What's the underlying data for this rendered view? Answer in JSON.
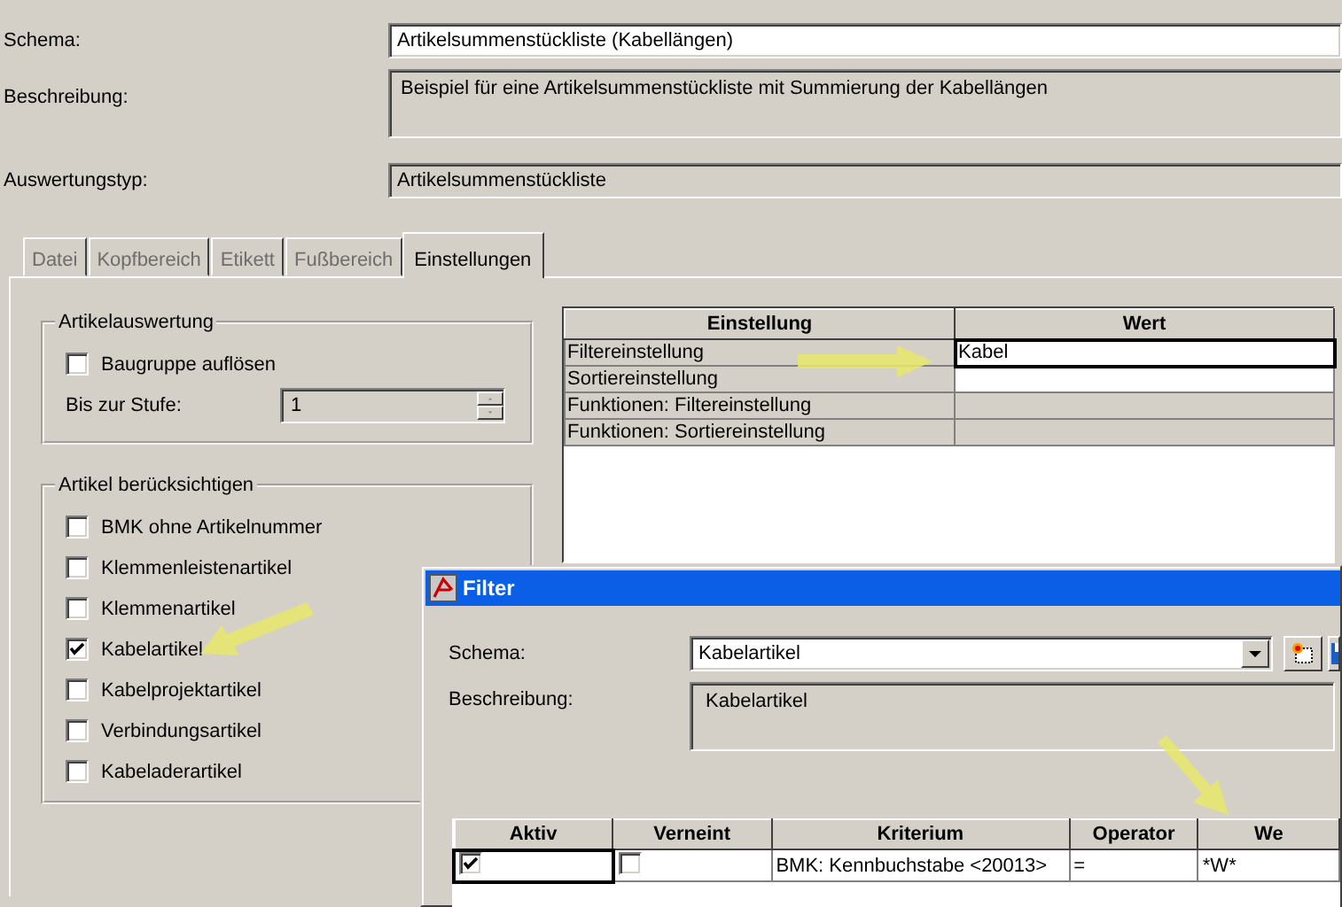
{
  "form": {
    "schema_label": "Schema:",
    "schema_value": "Artikelsummenstückliste (Kabellängen)",
    "beschreibung_label": "Beschreibung:",
    "beschreibung_value": "Beispiel für eine Artikelsummenstückliste mit Summierung der Kabellängen",
    "auswertungstyp_label": "Auswertungstyp:",
    "auswertungstyp_value": "Artikelsummenstückliste"
  },
  "tabs": [
    {
      "label": "Datei",
      "selected": false
    },
    {
      "label": "Kopfbereich",
      "selected": false
    },
    {
      "label": "Etikett",
      "selected": false
    },
    {
      "label": "Fußbereich",
      "selected": false
    },
    {
      "label": "Einstellungen",
      "selected": true
    }
  ],
  "artikelauswertung": {
    "title": "Artikelauswertung",
    "baugruppe": {
      "label": "Baugruppe auflösen",
      "checked": false
    },
    "stufe_label": "Bis zur Stufe:",
    "stufe_value": "1"
  },
  "artikel_beruecksichtigen": {
    "title": "Artikel berücksichtigen",
    "items": [
      {
        "label": "BMK ohne Artikelnummer",
        "checked": false
      },
      {
        "label": "Klemmenleistenartikel",
        "checked": false
      },
      {
        "label": "Klemmenartikel",
        "checked": false
      },
      {
        "label": "Kabelartikel",
        "checked": true
      },
      {
        "label": "Kabelprojektartikel",
        "checked": false
      },
      {
        "label": "Verbindungsartikel",
        "checked": false
      },
      {
        "label": "Kabeladerartikel",
        "checked": false
      }
    ]
  },
  "settings_table": {
    "columns": [
      "Einstellung",
      "Wert"
    ],
    "rows": [
      {
        "name": "Filtereinstellung",
        "value": "Kabel",
        "disabled": false
      },
      {
        "name": "Sortiereinstellung",
        "disabled": false
      },
      {
        "name": "Funktionen: Filtereinstellung",
        "disabled": true
      },
      {
        "name": "Funktionen: Sortiereinstellung",
        "disabled": true
      }
    ]
  },
  "filter_dialog": {
    "title": "Filter",
    "schema_label": "Schema:",
    "schema_value": "Kabelartikel",
    "beschreibung_label": "Beschreibung:",
    "beschreibung_value": "Kabelartikel",
    "table": {
      "columns": [
        "Aktiv",
        "Verneint",
        "Kriterium",
        "Operator",
        "We"
      ],
      "rows": [
        {
          "aktiv": true,
          "verneint": false,
          "kriterium": "BMK: Kennbuchstabe <20013>",
          "operator": "=",
          "wert": "*W*"
        }
      ]
    }
  }
}
